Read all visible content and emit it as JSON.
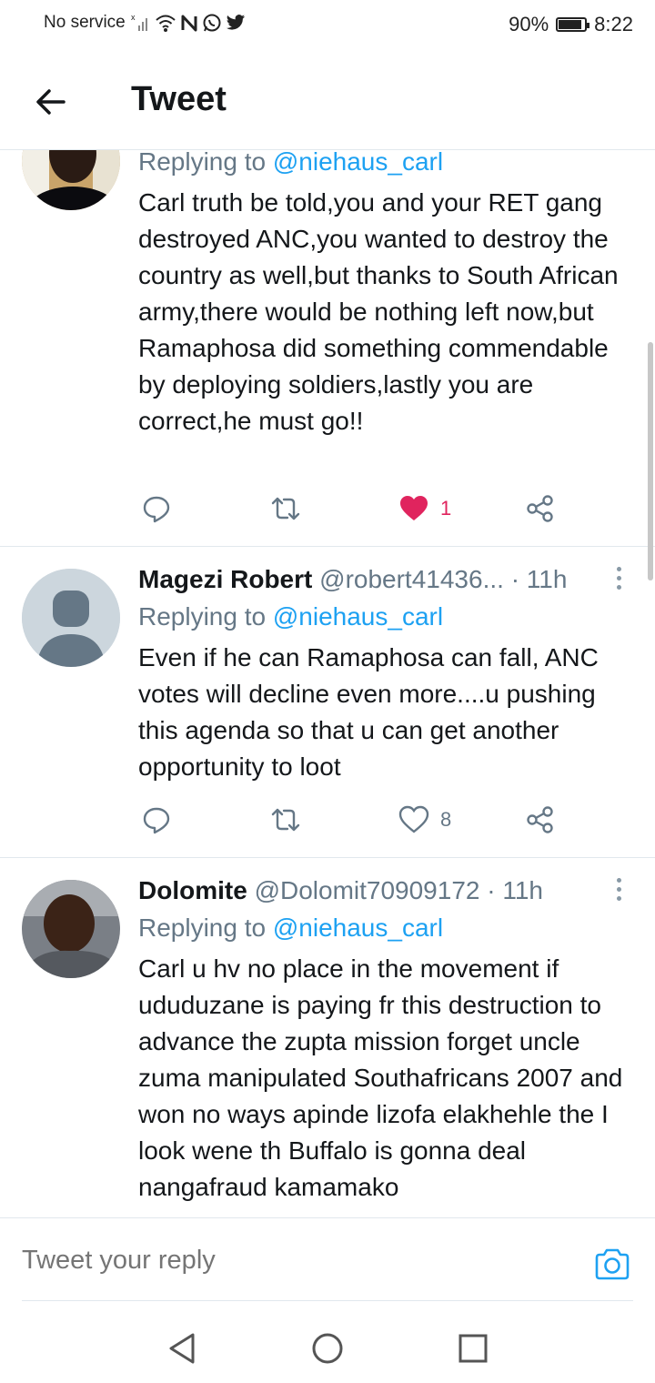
{
  "status_bar": {
    "carrier": "No service",
    "battery_percent": "90%",
    "battery_level": 0.9,
    "time": "8:22"
  },
  "header": {
    "title": "Tweet"
  },
  "tweets": [
    {
      "name": "",
      "handle": "",
      "time": "",
      "replying_label": "Replying to",
      "replying_handle": "@niehaus_carl",
      "text": "Carl truth be told,you and your RET gang destroyed ANC,you wanted to destroy the country as well,but thanks to South African army,there would be nothing left now,but Ramaphosa did something commendable by deploying soldiers,lastly you are correct,he must go!!",
      "like_count": "1",
      "liked": true
    },
    {
      "name": "Magezi Robert",
      "handle": "@robert41436...",
      "time": "· 11h",
      "replying_label": "Replying to",
      "replying_handle": "@niehaus_carl",
      "text": "Even if he can Ramaphosa can fall, ANC votes will decline even more....u pushing this agenda so that u can get another opportunity to loot",
      "like_count": "8",
      "liked": false
    },
    {
      "name": "Dolomite",
      "handle": "@Dolomit70909172",
      "time": "· 11h",
      "replying_label": "Replying to",
      "replying_handle": "@niehaus_carl",
      "text": "Carl u hv no place in  the movement if ududuzane is paying fr this destruction to advance the zupta mission forget uncle zuma manipulated Southafricans 2007 and won no ways apinde lizofa elakhehle the I look wene th Buffalo is gonna deal nangafraud kamamako"
    }
  ],
  "reply_bar": {
    "placeholder": "Tweet your reply"
  },
  "colors": {
    "accent": "#1da1f2",
    "like": "#e0245e",
    "muted": "#657786"
  }
}
